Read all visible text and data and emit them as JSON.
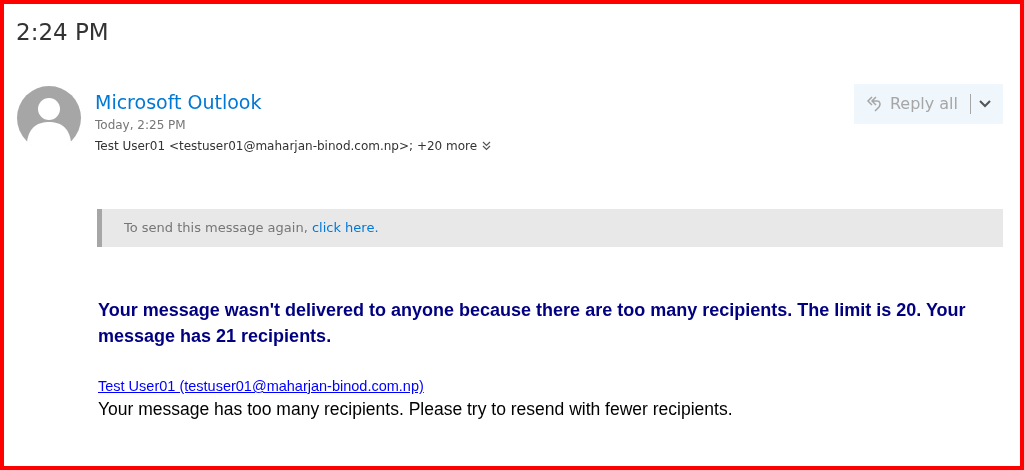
{
  "header": {
    "time": "2:24 PM"
  },
  "message": {
    "sender": "Microsoft Outlook",
    "date": "Today, 2:25 PM",
    "recipients": "Test User01 <testuser01@maharjan-binod.com.np>; +20 more",
    "reply_all": {
      "label": "Reply all",
      "disabled": true
    }
  },
  "banner": {
    "text": "To send this message again,",
    "link": "click here."
  },
  "body": {
    "headline": "Your message wasn't delivered to anyone because there are too many recipients. The limit is 20. Your message has 21 recipients.",
    "recipient_link": "Test User01 (testuser01@maharjan-binod.com.np)",
    "detail": "Your message has too many recipients. Please try to resend with fewer recipients."
  }
}
